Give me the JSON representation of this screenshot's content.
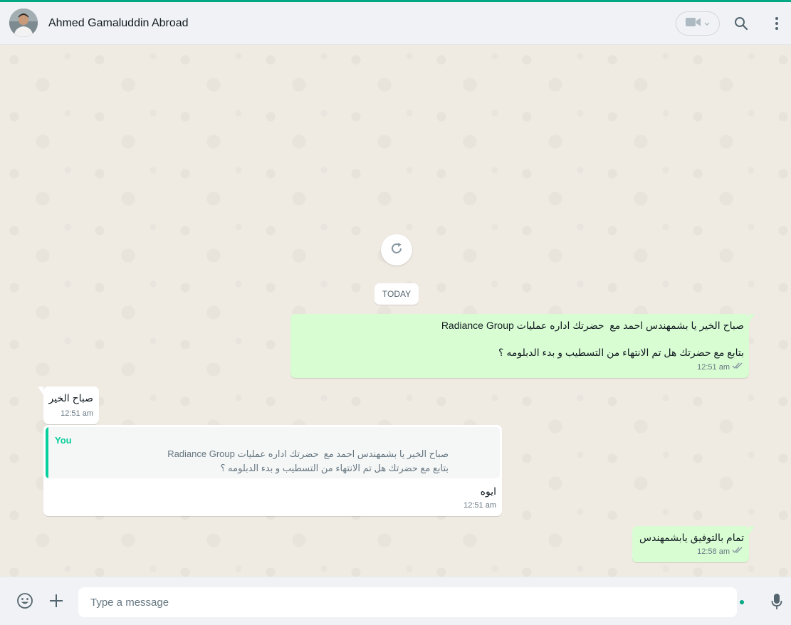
{
  "header": {
    "contact_name": "Ahmed Gamaluddin Abroad"
  },
  "chat": {
    "day_label": "TODAY",
    "messages": [
      {
        "direction": "outgoing",
        "text": "صباح الخير يا بشمهندس احمد مع  حضرتك اداره عمليات Radiance Group\n\nبتابع مع حضرتك هل تم الانتهاء من التسطيب و بدء الدبلومه ؟",
        "time": "12:51 am",
        "status": "delivered"
      },
      {
        "direction": "incoming",
        "text": "صباح الخير",
        "time": "12:51 am"
      },
      {
        "direction": "incoming",
        "quote": {
          "author": "You",
          "text": "صباح الخير يا بشمهندس احمد مع  حضرتك اداره عمليات Radiance Group\nبتابع مع حضرتك هل تم الانتهاء من التسطيب و بدء الدبلومه ؟"
        },
        "text": "ايوه",
        "time": "12:51 am"
      },
      {
        "direction": "outgoing",
        "text": "تمام بالتوفيق يابشمهندس",
        "time": "12:58 am",
        "status": "delivered"
      }
    ]
  },
  "composer": {
    "placeholder": "Type a message"
  },
  "icons": {
    "video_call": "video-camera-icon",
    "search": "search-icon",
    "menu": "more-vertical-icon",
    "refresh": "refresh-icon",
    "emoji": "emoji-icon",
    "attach": "plus-icon",
    "voice": "microphone-icon",
    "ticks": "double-check-icon"
  },
  "colors": {
    "accent": "#00a884",
    "outgoing_bubble": "#d9fdd3",
    "incoming_bubble": "#ffffff",
    "quote_accent": "#06cf9c",
    "tick": "#8696a0"
  }
}
